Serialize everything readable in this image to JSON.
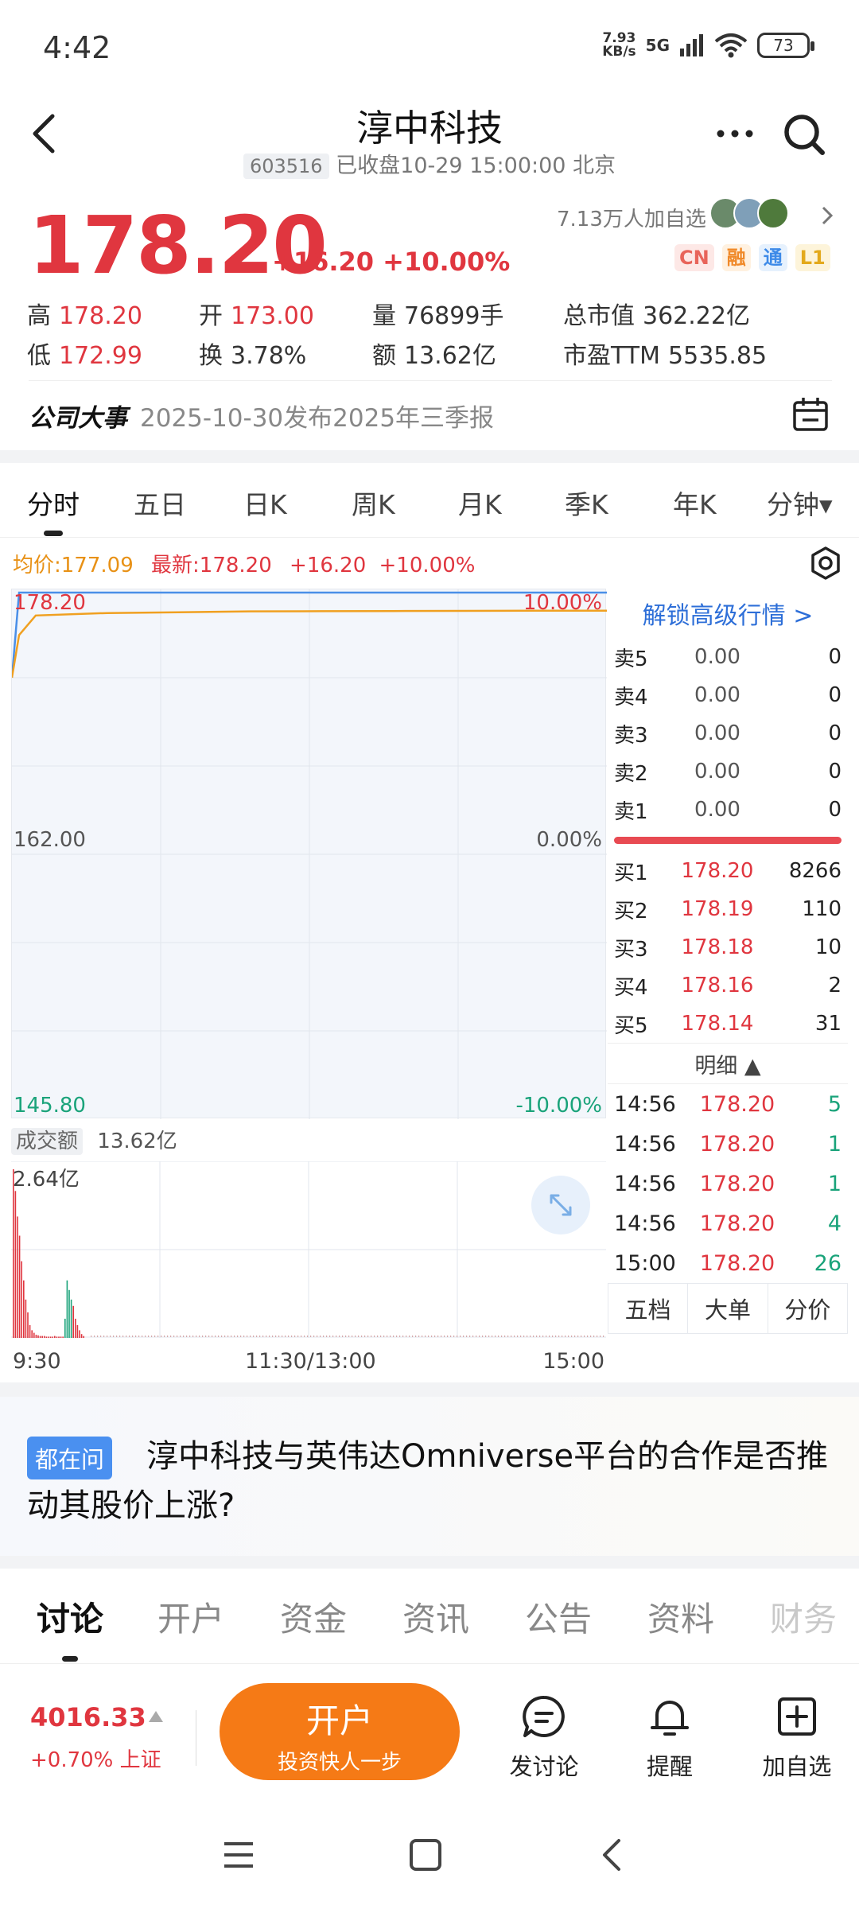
{
  "status_bar": {
    "time": "4:42",
    "net_speed": "7.93",
    "net_unit": "KB/s",
    "signal": "5G",
    "battery": "73"
  },
  "header": {
    "title": "淳中科技",
    "code": "603516",
    "status": "已收盘10-29 15:00:00 北京"
  },
  "quote": {
    "price": "178.20",
    "change": "+16.20 +10.00%",
    "followers": "7.13万人加自选",
    "tags": [
      "CN",
      "融",
      "通",
      "L1"
    ],
    "stats": [
      {
        "label": "高",
        "value": "178.20",
        "color": "red"
      },
      {
        "label": "开",
        "value": "173.00",
        "color": "red"
      },
      {
        "label": "量",
        "value": "76899手",
        "color": "dark"
      },
      {
        "label": "总市值",
        "value": "362.22亿",
        "color": "dark"
      },
      {
        "label": "低",
        "value": "172.99",
        "color": "red"
      },
      {
        "label": "换",
        "value": "3.78%",
        "color": "dark"
      },
      {
        "label": "额",
        "value": "13.62亿",
        "color": "dark"
      },
      {
        "label": "市盈TTM",
        "value": "5535.85",
        "color": "dark"
      }
    ]
  },
  "events": {
    "label": "公司大事",
    "text": "2025-10-30发布2025年三季报"
  },
  "chart_tabs": [
    "分时",
    "五日",
    "日K",
    "周K",
    "月K",
    "季K",
    "年K",
    "分钟▾"
  ],
  "info_line": {
    "avg": "均价:177.09",
    "latest": "最新:178.20",
    "change": "+16.20",
    "pct": "+10.00%"
  },
  "chart_data": {
    "type": "line",
    "x_ticks": [
      "9:30",
      "11:30/13:00",
      "15:00"
    ],
    "y_left_ticks": [
      "178.20",
      "162.00",
      "145.80"
    ],
    "y_right_ticks": [
      "10.00%",
      "0.00%",
      "-10.00%"
    ],
    "ylim": [
      145.8,
      178.2
    ],
    "series": [
      {
        "name": "最新",
        "color": "#4a8fe8",
        "values": [
          173.0,
          178.2,
          178.2,
          178.2,
          178.2,
          178.2,
          178.2,
          178.2,
          178.2,
          178.2,
          178.2
        ]
      },
      {
        "name": "均价",
        "color": "#f0a020",
        "values": [
          173.0,
          175.6,
          176.8,
          176.95,
          177.0,
          177.05,
          177.06,
          177.07,
          177.08,
          177.09,
          177.09
        ]
      }
    ],
    "volume": {
      "label": "成交额",
      "total": "13.62亿",
      "max_label": "2.64亿",
      "values": [
        2.64,
        2.3,
        1.9,
        1.6,
        1.2,
        0.9,
        0.6,
        0.4,
        0.2,
        0.12,
        0.08,
        0.05,
        0.04,
        0.03,
        0.03,
        0.03,
        0.02,
        0.02,
        0.02,
        0.02,
        0.03,
        0.02,
        0.02,
        0.02,
        0.02,
        0.3,
        0.9,
        0.75,
        0.6,
        0.5,
        0.3,
        0.2,
        0.12,
        0.06,
        0.03
      ]
    }
  },
  "order_book": {
    "unlock": "解锁高级行情 >",
    "sell": [
      {
        "label": "卖5",
        "price": "0.00",
        "qty": "0"
      },
      {
        "label": "卖4",
        "price": "0.00",
        "qty": "0"
      },
      {
        "label": "卖3",
        "price": "0.00",
        "qty": "0"
      },
      {
        "label": "卖2",
        "price": "0.00",
        "qty": "0"
      },
      {
        "label": "卖1",
        "price": "0.00",
        "qty": "0"
      }
    ],
    "buy": [
      {
        "label": "买1",
        "price": "178.20",
        "qty": "8266"
      },
      {
        "label": "买2",
        "price": "178.19",
        "qty": "110"
      },
      {
        "label": "买3",
        "price": "178.18",
        "qty": "10"
      },
      {
        "label": "买4",
        "price": "178.16",
        "qty": "2"
      },
      {
        "label": "买5",
        "price": "178.14",
        "qty": "31"
      }
    ],
    "detail_label": "明细 ▲",
    "details": [
      {
        "time": "14:56",
        "price": "178.20",
        "qty": "5"
      },
      {
        "time": "14:56",
        "price": "178.20",
        "qty": "1"
      },
      {
        "time": "14:56",
        "price": "178.20",
        "qty": "1"
      },
      {
        "time": "14:56",
        "price": "178.20",
        "qty": "4"
      },
      {
        "time": "15:00",
        "price": "178.20",
        "qty": "26"
      }
    ],
    "tabs": [
      "五档",
      "大单",
      "分价"
    ]
  },
  "qa": {
    "tag": "都在问",
    "text": "淳中科技与英伟达Omniverse平台的合作是否推动其股价上涨?"
  },
  "content_tabs": [
    "讨论",
    "开户",
    "资金",
    "资讯",
    "公告",
    "资料",
    "财务"
  ],
  "bottom_bar": {
    "index_value": "4016.33",
    "index_change": "+0.70% 上证",
    "open_main": "开户",
    "open_sub": "投资快人一步",
    "actions": [
      {
        "label": "发讨论",
        "icon": "comment-icon"
      },
      {
        "label": "提醒",
        "icon": "bell-icon"
      },
      {
        "label": "加自选",
        "icon": "add-watchlist-icon"
      }
    ]
  },
  "colors": {
    "up": "#e0363f",
    "down": "#1aa37a",
    "avg": "#e89116",
    "accent": "#f57a16",
    "link": "#2e6fd8"
  }
}
